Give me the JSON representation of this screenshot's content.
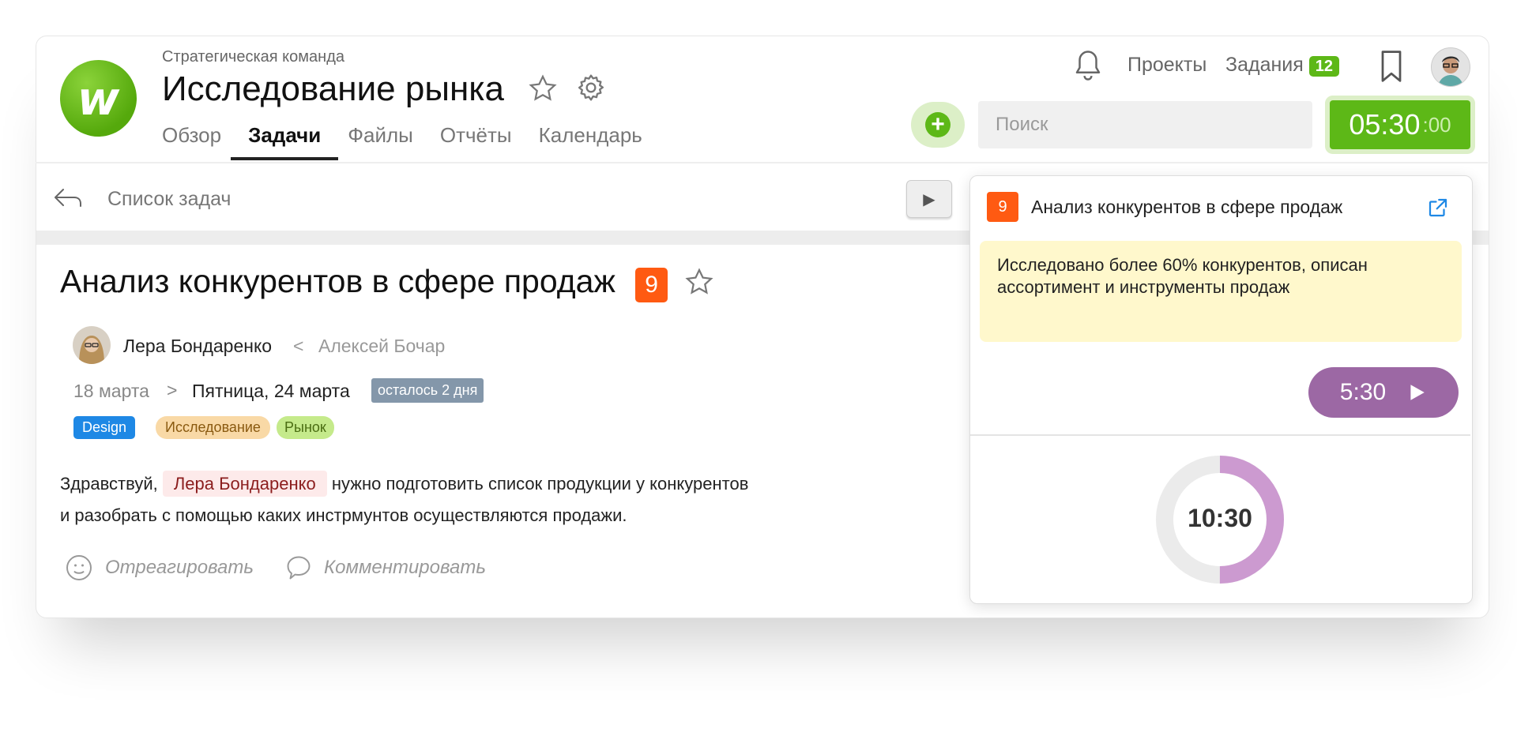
{
  "header": {
    "team": "Стратегическая команда",
    "project_title": "Исследование рынка",
    "tabs": [
      "Обзор",
      "Задачи",
      "Файлы",
      "Отчёты",
      "Календарь"
    ],
    "active_tab": "Задачи",
    "nav": {
      "projects": "Проекты",
      "tasks": "Задания",
      "tasks_count": "12"
    },
    "search": {
      "placeholder": "Поиск"
    },
    "timer": {
      "main": "05:30",
      "seconds": ":00"
    }
  },
  "subbar": {
    "back_label": "Список задач"
  },
  "task": {
    "title": "Анализ конкурентов в сфере продаж",
    "priority": "9",
    "assignee": "Лера Бондаренко",
    "separator": "<",
    "author": "Алексей Бочар",
    "date_start": "18 марта",
    "date_arrow": ">",
    "date_end": "Пятница, 24 марта",
    "remaining": "осталось 2 дня",
    "tags": [
      {
        "label": "Design",
        "color": "#1e88e5"
      },
      {
        "label": "Исследование",
        "color": "#f9d9a6"
      },
      {
        "label": "Рынок",
        "color": "#c5ea8b"
      }
    ],
    "desc_prefix": "Здравствуй,",
    "desc_mention": "Лера Бондаренко",
    "desc_rest": "нужно подготовить список продукции у конкурентов",
    "desc_line2": "и разобрать с помощью каких инстрмунтов осуществляются продажи.",
    "react_label": "Отреагировать",
    "comment_label": "Комментировать"
  },
  "panel": {
    "priority": "9",
    "title": "Анализ конкурентов в сфере продаж",
    "note_line1": "Исследовано более 60% конкурентов, описан",
    "note_line2": "ассортимент и инструменты продаж",
    "play_time": "5:30",
    "total_time": "10:30",
    "progress": 0.5
  },
  "colors": {
    "green": "#5db817",
    "orange": "#ff5a12",
    "purple": "#9c68a4",
    "ring": "#cc9ad0"
  }
}
